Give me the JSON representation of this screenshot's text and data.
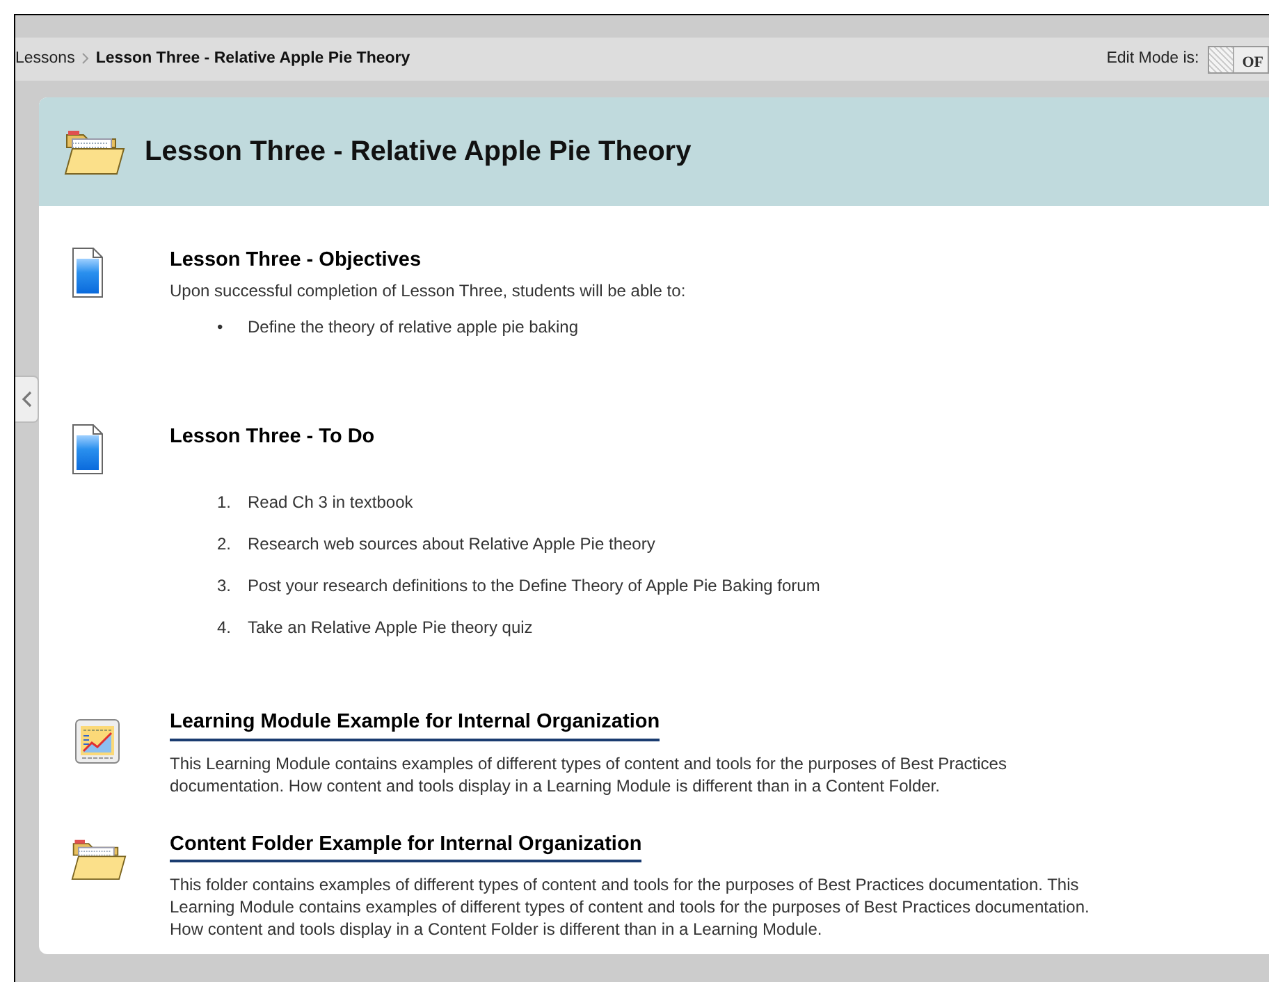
{
  "breadcrumb": {
    "items": [
      {
        "label": "Lessons",
        "current": false
      },
      {
        "label": "Lesson Three - Relative Apple Pie Theory",
        "current": true
      }
    ]
  },
  "edit_mode": {
    "label": "Edit Mode is:",
    "on": false,
    "value": "OF"
  },
  "panel": {
    "title": "Lesson Three - Relative Apple Pie Theory"
  },
  "items": [
    {
      "kind": "document",
      "title": "Lesson Three - Objectives",
      "link": false,
      "text": [
        "Upon successful completion of Lesson Three, students will be able to:"
      ],
      "list": [
        {
          "marker": "•",
          "text": "Define the theory of relative apple pie baking"
        }
      ]
    },
    {
      "kind": "document",
      "title": "Lesson Three - To Do",
      "link": false,
      "list": [
        {
          "marker": "1.",
          "text": "Read Ch 3 in textbook"
        },
        {
          "marker": "2.",
          "text": "Research web sources about Relative Apple Pie theory"
        },
        {
          "marker": "3.",
          "text": "Post your research definitions to the Define Theory of Apple Pie Baking forum"
        },
        {
          "marker": "4.",
          "text": "Take an Relative Apple Pie theory quiz"
        }
      ]
    },
    {
      "kind": "module",
      "title": "Learning Module Example for Internal Organization",
      "link": true,
      "text": [
        "This Learning Module contains examples of different types of content and tools for the purposes of Best Practices",
        "documentation.  How content and tools display in a Learning Module is different than in a Content Folder."
      ]
    },
    {
      "kind": "folder",
      "title": "Content Folder Example for Internal Organization",
      "link": true,
      "text": [
        "This folder contains examples of different types of content and tools for the purposes of Best Practices documentation.  This",
        "Learning Module contains examples of different types of content and tools for the purposes of Best Practices documentation.",
        "How content and tools display in a Content Folder is different than in a Learning Module."
      ]
    }
  ]
}
